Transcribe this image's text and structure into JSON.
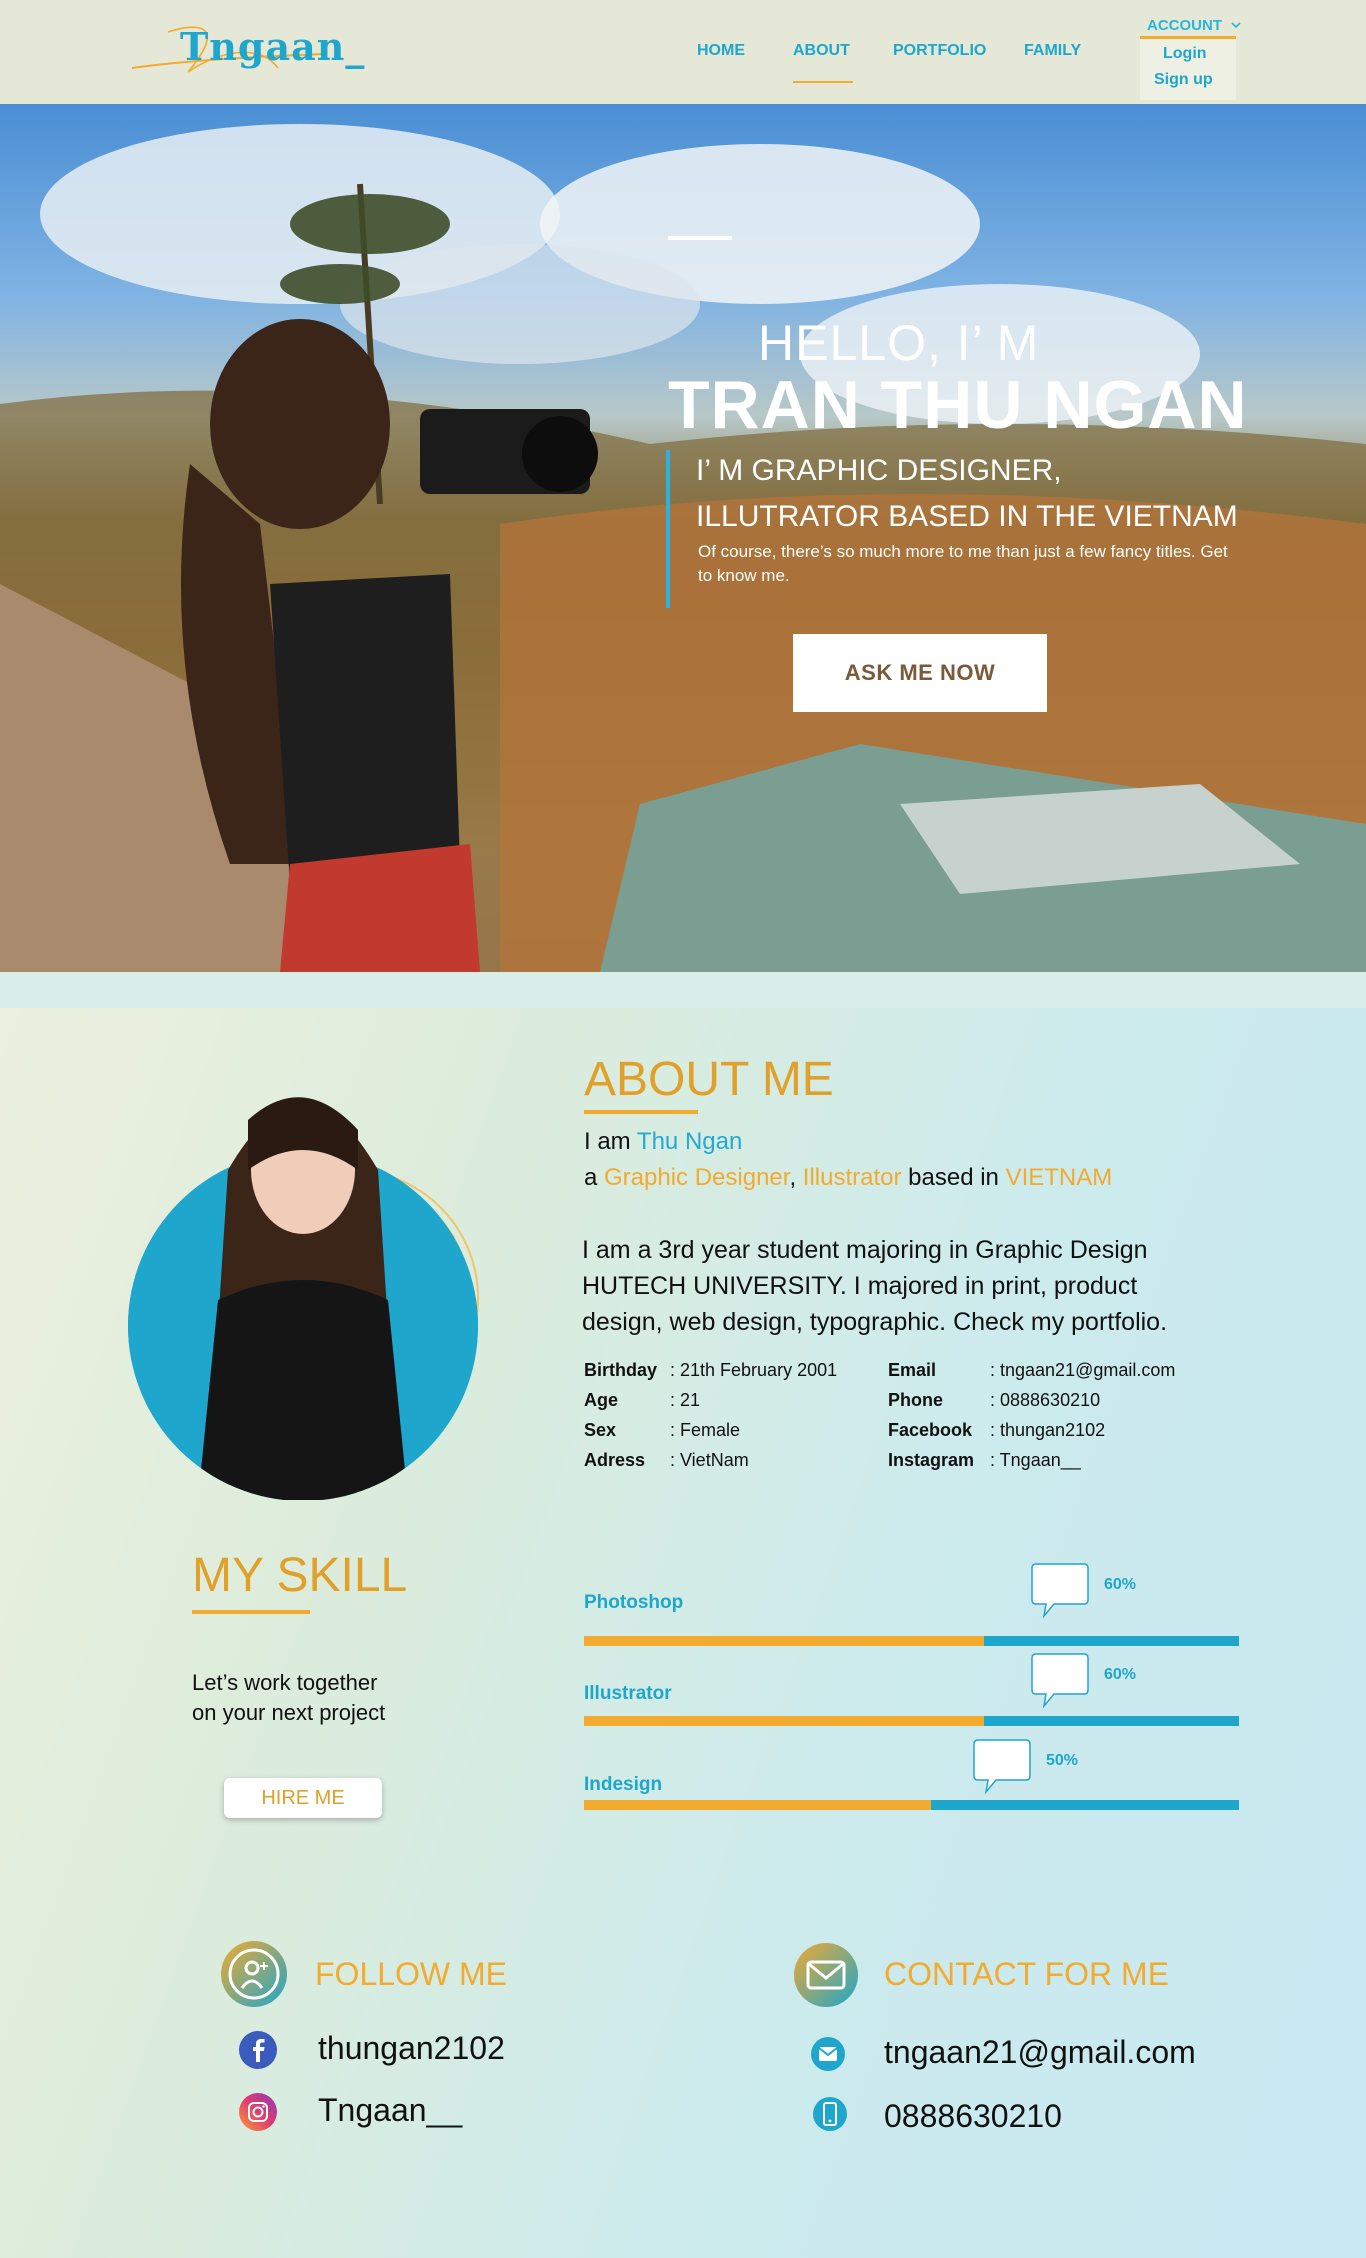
{
  "header": {
    "logo_text": "Tngaan_",
    "nav": [
      {
        "label": "HOME"
      },
      {
        "label": "ABOUT"
      },
      {
        "label": "PORTFOLIO"
      },
      {
        "label": "FAMILY"
      }
    ],
    "account": {
      "label": "ACCOUNT",
      "items": [
        "Login",
        "Sign up"
      ]
    }
  },
  "hero": {
    "hello": "HELLO, I’ M",
    "name": "TRAN THU NGAN",
    "subtitle_1": "I’ M GRAPHIC DESIGNER,",
    "subtitle_2": "ILLUTRATOR BASED IN THE VIETNAM",
    "description": "Of course, there’s so much more to me than just a few fancy titles. Get to know me.",
    "cta": "ASK ME NOW"
  },
  "about": {
    "title": "ABOUT ME",
    "line1_prefix": "I am ",
    "line1_name": "Thu Ngan",
    "line2_a": "a ",
    "line2_role1": "Graphic Designer",
    "line2_comma": ", ",
    "line2_role2": "Illustrator",
    "line2_based": " based in ",
    "line2_country": "VIETNAM",
    "paragraph": "I am a 3rd year student majoring in Graphic Design HUTECH UNIVERSITY. I majored in print, product design, web design, typographic. Check my portfolio.",
    "info_left": [
      {
        "label": "Birthday",
        "value": ": 21th February 2001"
      },
      {
        "label": "Age",
        "value": ": 21"
      },
      {
        "label": "Sex",
        "value": ": Female"
      },
      {
        "label": "Adress",
        "value": ": VietNam"
      }
    ],
    "info_right": [
      {
        "label": "Email",
        "value": ": tngaan21@gmail.com"
      },
      {
        "label": "Phone",
        "value": ": 0888630210"
      },
      {
        "label": "Facebook",
        "value": ": thungan2102"
      },
      {
        "label": "Instagram",
        "value": ": Tngaan__"
      }
    ]
  },
  "skills": {
    "title": "MY SKILL",
    "blurb_1": "Let’s work together",
    "blurb_2": "on your next project",
    "hire": "HIRE ME",
    "items": [
      {
        "name": "Photoshop",
        "percent_label": "60%",
        "level": 0.61
      },
      {
        "name": "Illustrator",
        "percent_label": "60%",
        "level": 0.61
      },
      {
        "name": "Indesign",
        "percent_label": "50%",
        "level": 0.53
      }
    ]
  },
  "follow": {
    "title": "FOLLOW ME",
    "facebook": "thungan2102",
    "instagram": "Tngaan__"
  },
  "contact": {
    "title": "CONTACT FOR ME",
    "email": "tngaan21@gmail.com",
    "phone": "0888630210"
  },
  "colors": {
    "accent_blue": "#1ea6cc",
    "accent_orange": "#f2aa2f",
    "header_bg": "#e6e8d7"
  }
}
